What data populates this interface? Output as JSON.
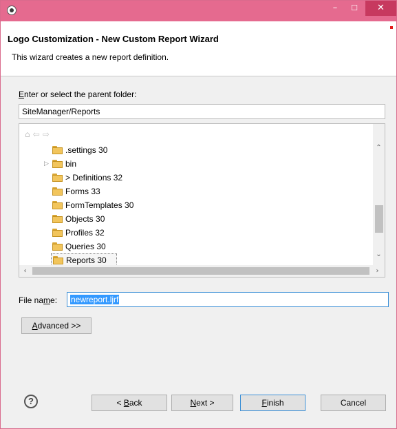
{
  "window": {
    "title_buttons": {
      "minimize": "–",
      "maximize": "☐",
      "close": "✕"
    }
  },
  "header": {
    "title": "Logo Customization - New Custom Report Wizard",
    "description": "This wizard creates a new report definition."
  },
  "folder": {
    "label_accel": "E",
    "label_rest": "nter or select the parent folder:",
    "value": "SiteManager/Reports"
  },
  "tree": {
    "nav_icons": [
      "home-icon",
      "back-arrow-icon",
      "forward-arrow-icon"
    ],
    "items": [
      {
        "label": ".settings 30",
        "expandable": false
      },
      {
        "label": "bin",
        "expandable": true
      },
      {
        "label": "> Definitions 32",
        "expandable": false
      },
      {
        "label": "Forms 33",
        "expandable": false
      },
      {
        "label": "FormTemplates 30",
        "expandable": false
      },
      {
        "label": "Objects 30",
        "expandable": false
      },
      {
        "label": "Profiles 32",
        "expandable": false
      },
      {
        "label": "Queries 30",
        "expandable": false
      },
      {
        "label": "Reports 30",
        "expandable": false,
        "selected": true
      }
    ]
  },
  "file_name": {
    "label_accel": "m",
    "label_pre": "File na",
    "label_post": "e:",
    "value": "newreport.ljrf"
  },
  "buttons": {
    "advanced_accel": "A",
    "advanced_rest": "dvanced >>",
    "back_pre": "< ",
    "back_accel": "B",
    "back_rest": "ack",
    "next_accel": "N",
    "next_rest": "ext >",
    "finish_accel": "F",
    "finish_rest": "inish",
    "cancel": "Cancel",
    "help": "?"
  },
  "colors": {
    "titlebar": "#e56a8f",
    "close_button": "#c7395f",
    "selection": "#3399ff",
    "focus_border": "#3c8fd6",
    "folder": "#f2c55c"
  }
}
